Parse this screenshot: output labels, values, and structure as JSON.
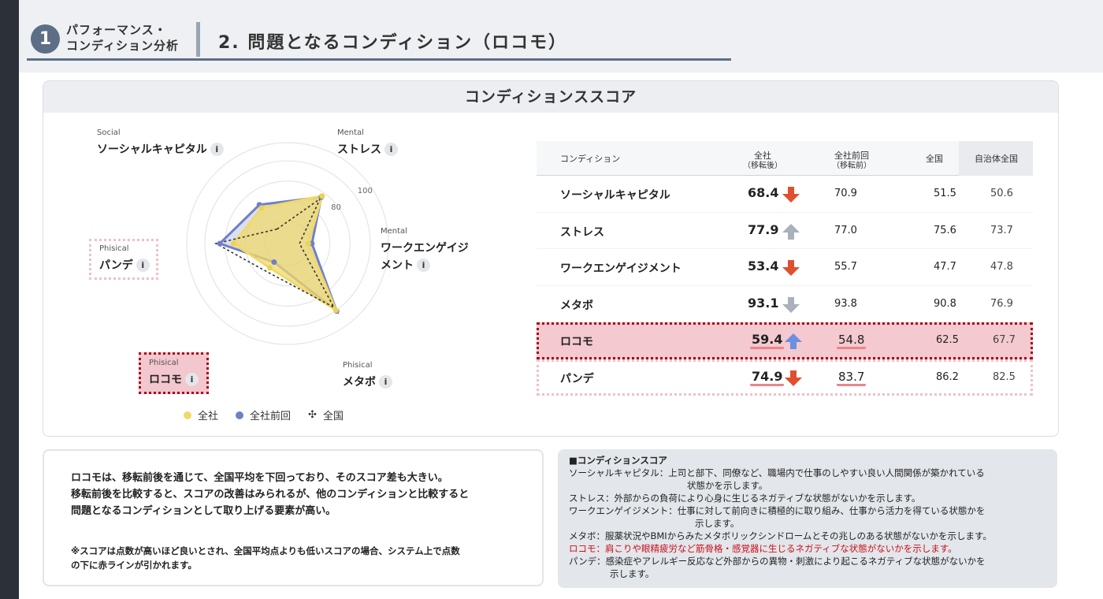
{
  "header": {
    "step_number": "1",
    "step_label_line1": "パフォーマンス・",
    "step_label_line2": "コンディション分析",
    "title": "2. 問題となるコンディション（ロコモ）"
  },
  "score_card": {
    "title": "コンディションススコア",
    "radar": {
      "axes": [
        {
          "key": "social",
          "category": "Social",
          "label": "ソーシャルキャピタル"
        },
        {
          "key": "stress",
          "category": "Mental",
          "label": "ストレス"
        },
        {
          "key": "work",
          "category": "Mental",
          "label_line1": "ワークエンゲイジ",
          "label_line2": "メント"
        },
        {
          "key": "metabo",
          "category": "Phisical",
          "label": "メタボ"
        },
        {
          "key": "locomo",
          "category": "Phisical",
          "label": "ロコモ"
        },
        {
          "key": "pande",
          "category": "Phisical",
          "label": "パンデ"
        }
      ],
      "info_glyph": "i",
      "tick_labels": [
        "80",
        "100"
      ],
      "legend": [
        {
          "label": "全社",
          "color": "#f0d96a"
        },
        {
          "label": "全社前回",
          "color": "#6f7fc8"
        },
        {
          "label": "全国",
          "glyph": "✣"
        }
      ]
    },
    "table": {
      "headers": {
        "condition": "コンディション",
        "company": "全社",
        "company_sub": "（移転後）",
        "prev": "全社前回",
        "prev_sub": "（移転前）",
        "national": "全国",
        "industry": "自治体全国"
      },
      "rows": [
        {
          "name": "ソーシャルキャピタル",
          "score": "68.4",
          "trend": "down",
          "prev": "70.9",
          "national": "51.5",
          "industry": "50.6"
        },
        {
          "name": "ストレス",
          "score": "77.9",
          "trend": "up-gray",
          "prev": "77.0",
          "national": "75.6",
          "industry": "73.7"
        },
        {
          "name": "ワークエンゲイジメント",
          "score": "53.4",
          "trend": "down",
          "prev": "55.7",
          "national": "47.7",
          "industry": "47.8"
        },
        {
          "name": "メタボ",
          "score": "93.1",
          "trend": "down-gray",
          "prev": "93.8",
          "national": "90.8",
          "industry": "76.9"
        },
        {
          "name": "ロコモ",
          "score": "59.4",
          "trend": "up",
          "prev": "54.8",
          "national": "62.5",
          "industry": "67.7"
        },
        {
          "name": "パンデ",
          "score": "74.9",
          "trend": "down",
          "prev": "83.7",
          "national": "86.2",
          "industry": "82.5"
        }
      ]
    }
  },
  "chart_data": {
    "type": "radar",
    "categories": [
      "ソーシャルキャピタル",
      "ストレス",
      "ワークエンゲイジメント",
      "メタボ",
      "ロコモ",
      "パンデ"
    ],
    "series": [
      {
        "name": "全社",
        "values": [
          68.4,
          77.9,
          53.4,
          93.1,
          59.4,
          74.9
        ]
      },
      {
        "name": "全社前回",
        "values": [
          70.9,
          77.0,
          55.7,
          93.8,
          54.8,
          83.7
        ]
      },
      {
        "name": "全国",
        "values": [
          51.5,
          75.6,
          47.7,
          90.8,
          62.5,
          86.2
        ]
      }
    ],
    "tick_labels": [
      "80",
      "100"
    ],
    "legend": "bottom"
  },
  "note": {
    "line1": "ロコモは、移転前後を通じて、全国平均を下回っており、そのスコア差も大きい。",
    "line2": "移転前後を比較すると、スコアの改善はみられるが、他のコンディションと比較すると",
    "line3": "問題となるコンディションとして取り上げる要素が高い。",
    "foot1": "※スコアは点数が高いほど良いとされ、全国平均点よりも低いスコアの場合、システム上で点数",
    "foot2": "の下に赤ラインが引かれます。"
  },
  "definitions": {
    "title": "■コンディションスコア",
    "lines": [
      "ソーシャルキャピタル：上司と部下、同僚など、職場内で仕事のしやすい良い人間関係が築かれている",
      "状態かを示します。",
      "ストレス：外部からの負荷により心身に生じるネガティブな状態がないかを示します。",
      "ワークエンゲイジメント：仕事に対して前向きに積極的に取り組み、仕事から活力を得ている状態かを",
      "示します。",
      "メタボ：服薬状況やBMIからみたメタボリックシンドロームとその兆しのある状態がないかを示します。",
      "ロコモ：肩こりや眼精疲労など筋骨格・感覚器に生じるネガティブな状態がないかを示します。",
      "パンデ：感染症やアレルギー反応など外部からの異物・刺激により起こるネガティブな状態がないかを",
      "示します。"
    ]
  },
  "colors": {
    "accent": "#5d6f86",
    "highlight_red": "#a0101c",
    "arrow_red": "#e0502f",
    "arrow_blue": "#6e8fe0",
    "arrow_gray": "#a9b1bb"
  }
}
